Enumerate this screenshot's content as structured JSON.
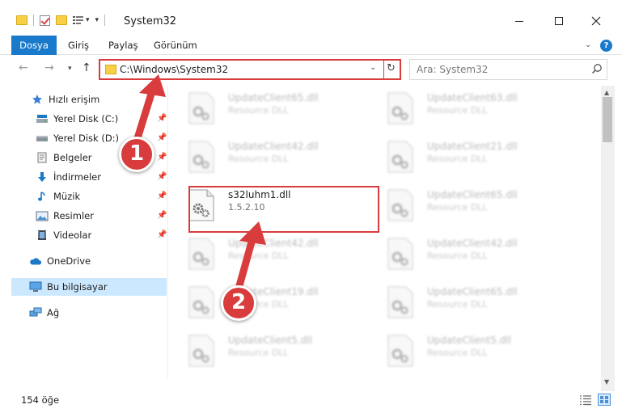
{
  "window": {
    "title": "System32",
    "controls": {
      "minimize_icon": "minimize-icon",
      "maximize_icon": "maximize-icon",
      "close_icon": "close-icon"
    }
  },
  "ribbon": {
    "tabs": [
      {
        "label": "Dosya",
        "active": true
      },
      {
        "label": "Giriş"
      },
      {
        "label": "Paylaş"
      },
      {
        "label": "Görünüm"
      }
    ],
    "help_label": "?"
  },
  "address": {
    "path": "C:\\Windows\\System32",
    "highlight_color": "#d83c3c"
  },
  "search": {
    "placeholder": "Ara: System32"
  },
  "sidebar": {
    "items": [
      {
        "label": "Hızlı erişim",
        "icon": "star-icon",
        "pinned": false
      },
      {
        "label": "Yerel Disk (C:)",
        "icon": "drive-icon",
        "pinned": true
      },
      {
        "label": "Yerel Disk (D:)",
        "icon": "drive-icon",
        "pinned": true
      },
      {
        "label": "Belgeler",
        "icon": "documents-icon",
        "pinned": true
      },
      {
        "label": "İndirmeler",
        "icon": "download-icon",
        "pinned": true
      },
      {
        "label": "Müzik",
        "icon": "music-icon",
        "pinned": true
      },
      {
        "label": "Resimler",
        "icon": "pictures-icon",
        "pinned": true
      },
      {
        "label": "Videolar",
        "icon": "videos-icon",
        "pinned": true
      },
      {
        "label": "OneDrive",
        "icon": "cloud-icon",
        "pinned": false
      },
      {
        "label": "Bu bilgisayar",
        "icon": "computer-icon",
        "pinned": false,
        "selected": true
      },
      {
        "label": "Ağ",
        "icon": "network-icon",
        "pinned": false
      }
    ]
  },
  "files": [
    {
      "name": "UpdateClient65.dll",
      "desc": "Resource DLL",
      "blurred": true
    },
    {
      "name": "UpdateClient63.dll",
      "desc": "Resource DLL",
      "blurred": true
    },
    {
      "name": "UpdateClient42.dll",
      "desc": "Resource DLL",
      "blurred": true
    },
    {
      "name": "UpdateClient21.dll",
      "desc": "Resource DLL",
      "blurred": true
    },
    {
      "name": "s32luhm1.dll",
      "desc": "1.5.2.10",
      "blurred": false
    },
    {
      "name": "UpdateClient65.dll",
      "desc": "Resource DLL",
      "blurred": true
    },
    {
      "name": "UpdateClient42.dll",
      "desc": "Resource DLL",
      "blurred": true
    },
    {
      "name": "UpdateClient42.dll",
      "desc": "Resource DLL",
      "blurred": true
    },
    {
      "name": "UpdateClient19.dll",
      "desc": "Resource DLL",
      "blurred": true
    },
    {
      "name": "UpdateClient65.dll",
      "desc": "Resource DLL",
      "blurred": true
    },
    {
      "name": "UpdateClient5.dll",
      "desc": "Resource DLL",
      "blurred": true
    },
    {
      "name": "UpdateClient5.dll",
      "desc": "Resource DLL",
      "blurred": true
    }
  ],
  "status": {
    "count": "154 öğe"
  },
  "annotations": {
    "callout_1": "1",
    "callout_2": "2",
    "color": "#d83c3c"
  }
}
